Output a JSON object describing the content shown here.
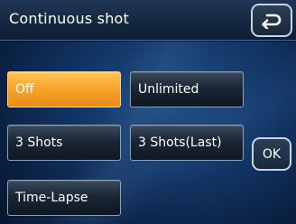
{
  "header": {
    "title": "Continuous shot",
    "back_icon": "return-arrow-icon"
  },
  "options": [
    {
      "label": "Off",
      "selected": true
    },
    {
      "label": "Unlimited",
      "selected": false
    },
    {
      "label": "3 Shots",
      "selected": false
    },
    {
      "label": "3 Shots(Last)",
      "selected": false
    },
    {
      "label": "Time-Lapse",
      "selected": false
    }
  ],
  "ok_label": "OK",
  "colors": {
    "selected_accent": "#f7a42a",
    "background": "#123463"
  }
}
